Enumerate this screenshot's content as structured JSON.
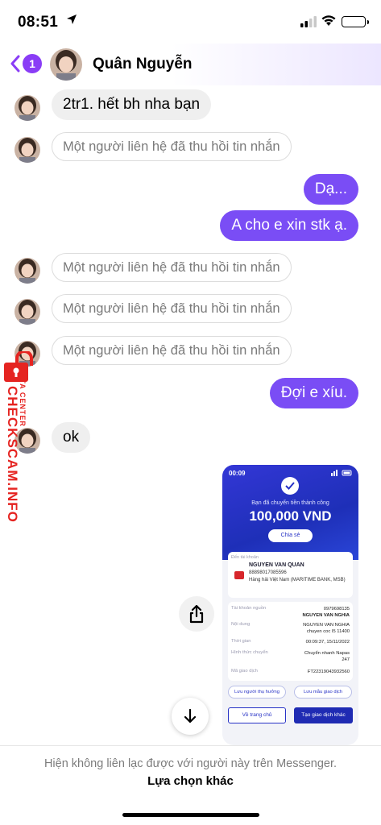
{
  "status_bar": {
    "time": "08:51",
    "icons": [
      "location-arrow-icon",
      "signal-icon",
      "wifi-icon",
      "battery-icon"
    ]
  },
  "header": {
    "unread_count": "1",
    "contact_name": "Quân Nguyễn"
  },
  "messages": [
    {
      "side": "in",
      "type": "text",
      "text": "2tr1. hết bh nha bạn"
    },
    {
      "side": "in",
      "type": "unsent",
      "text": "Một người liên hệ đã thu hồi tin nhắn"
    },
    {
      "side": "out",
      "type": "text",
      "text": "Dạ..."
    },
    {
      "side": "out",
      "type": "text",
      "text": "A cho e xin stk ạ."
    },
    {
      "side": "in",
      "type": "unsent",
      "text": "Một người liên hệ đã thu hồi tin nhắn"
    },
    {
      "side": "in",
      "type": "unsent",
      "text": "Một người liên hệ đã thu hồi tin nhắn"
    },
    {
      "side": "in",
      "type": "unsent",
      "text": "Một người liên hệ đã thu hồi tin nhắn"
    },
    {
      "side": "out",
      "type": "text",
      "text": "Đợi e xíu."
    },
    {
      "side": "in",
      "type": "text",
      "text": "ok"
    }
  ],
  "watermark": {
    "main": "CHECKSCAM.INFO",
    "sub": "DATA CENTER"
  },
  "receipt": {
    "status_time": "00:09",
    "success_text": "Bạn đã chuyển tiền thành công",
    "amount": "100,000 VND",
    "share_label": "Chia sẻ",
    "recipient_label": "Đến tài khoản",
    "recipient_name": "NGUYEN VAN QUAN",
    "recipient_account": "88898017085596",
    "recipient_bank": "Hàng hải Việt Nam (MARITIME BANK, MSB)",
    "details": [
      {
        "key": "Tài khoản nguồn",
        "value": "0979698135",
        "value2": "NGUYEN VAN NGHIA"
      },
      {
        "key": "Nội dung",
        "value": "NGUYEN VAN NGHIA",
        "value2": "chuyen coc I5 11400"
      },
      {
        "key": "Thời gian",
        "value": "00:09:37, 15/11/2022",
        "value2": ""
      },
      {
        "key": "Hình thức chuyển",
        "value": "Chuyển nhanh Napas",
        "value2": "247"
      },
      {
        "key": "Mã giao dịch",
        "value": "FT22319043932560",
        "value2": ""
      }
    ],
    "save_recipient": "Lưu người thụ hưởng",
    "save_template": "Lưu mẫu giao dịch",
    "home_button": "Về trang chủ",
    "new_transaction_button": "Tạo giao dịch khác"
  },
  "footer": {
    "notice": "Hiện không liên lạc được với người này trên Messenger.",
    "other_option": "Lựa chọn khác"
  },
  "colors": {
    "accent": "#7a4df5",
    "badge": "#8a3df6",
    "watermark": "#e52421",
    "receipt_blue": "#1f2bb3"
  }
}
